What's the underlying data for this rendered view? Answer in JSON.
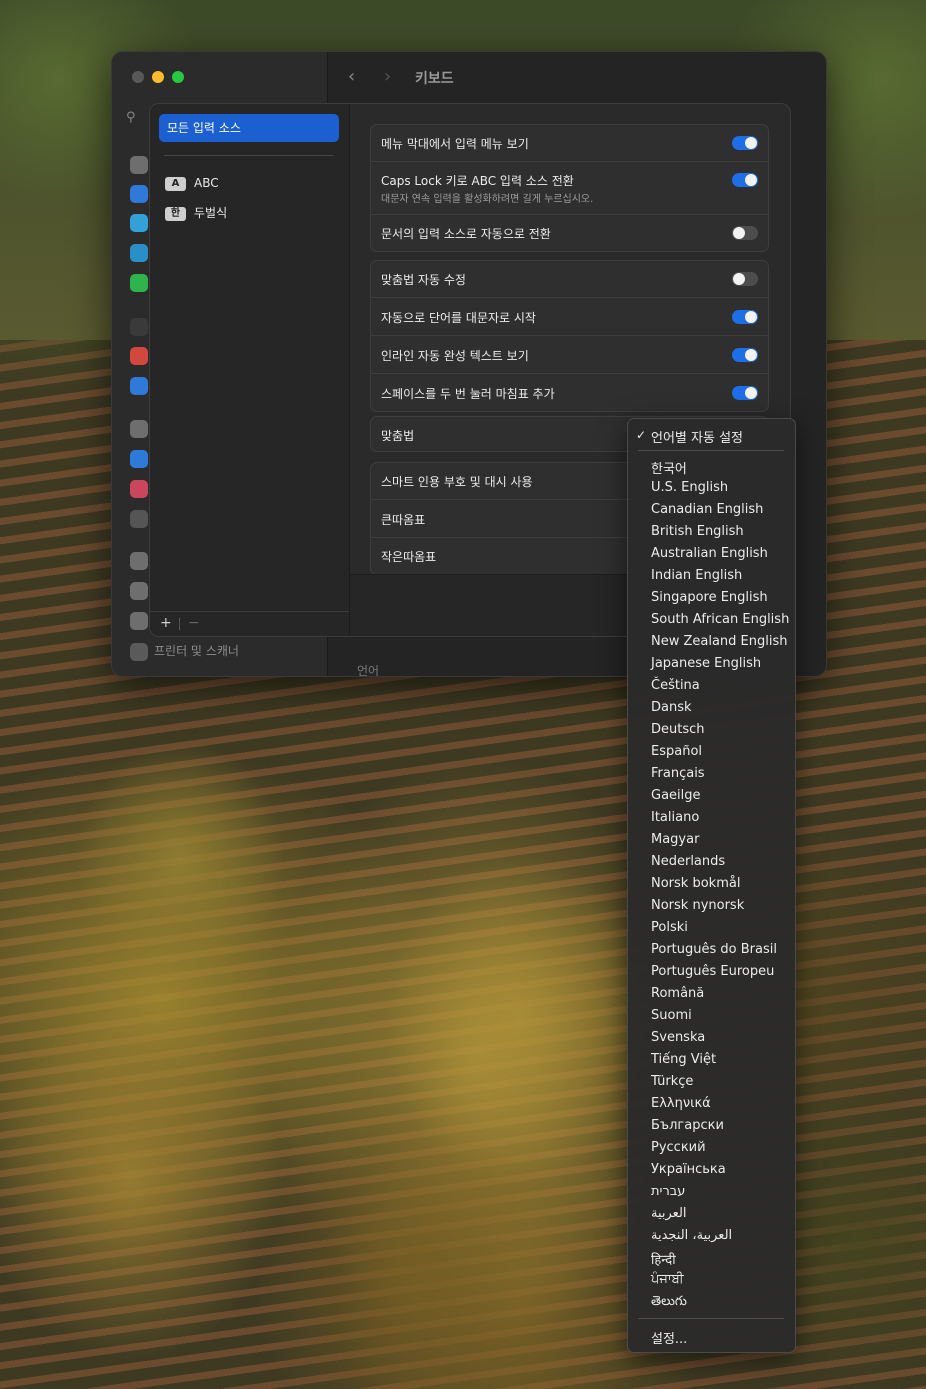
{
  "window": {
    "title": "키보드",
    "sidebar_footer": "프린터 및 스캐너",
    "background_label": "언어"
  },
  "sources": {
    "selected": "모든 입력 소스",
    "items": [
      {
        "badge": "A",
        "label": "ABC"
      },
      {
        "badge": "한",
        "label": "두벌식"
      }
    ],
    "add": "+",
    "remove": "−"
  },
  "settings": {
    "group1": [
      {
        "label": "메뉴 막대에서 입력 메뉴 보기",
        "on": true
      },
      {
        "label": "Caps Lock 키로 ABC 입력 소스 전환",
        "sub": "대문자 연속 입력을 활성화하려면 길게 누르십시오.",
        "on": true
      },
      {
        "label": "문서의 입력 소스로 자동으로 전환",
        "on": false
      }
    ],
    "group2": [
      {
        "label": "맞춤법 자동 수정",
        "on": false
      },
      {
        "label": "자동으로 단어를 대문자로 시작",
        "on": true
      },
      {
        "label": "인라인 자동 완성 텍스트 보기",
        "on": true
      },
      {
        "label": "스페이스를 두 번 눌러 마침표 추가",
        "on": true
      }
    ],
    "spelling_label": "맞춤법",
    "group4": [
      "스마트 인용 부호 및 대시 사용",
      "큰따옴표",
      "작은따옴표"
    ]
  },
  "spelling_menu": {
    "checked_item": "언어별 자동 설정",
    "languages": [
      "한국어",
      "U.S. English",
      "Canadian English",
      "British English",
      "Australian English",
      "Indian English",
      "Singapore English",
      "South African English",
      "New Zealand English",
      "Japanese English",
      "Čeština",
      "Dansk",
      "Deutsch",
      "Español",
      "Français",
      "Gaeilge",
      "Italiano",
      "Magyar",
      "Nederlands",
      "Norsk bokmål",
      "Norsk nynorsk",
      "Polski",
      "Português do Brasil",
      "Português Europeu",
      "Română",
      "Suomi",
      "Svenska",
      "Tiếng Việt",
      "Türkçe",
      "Ελληνικά",
      "Български",
      "Русский",
      "Українська",
      "עברית",
      "العربية",
      "العربية، النجدية",
      "हिन्दी",
      "ਪੰਜਾਬੀ",
      "తెలుగు"
    ],
    "settings_item": "설정..."
  },
  "colors": {
    "accent": "#1b5fd1",
    "toggle_on": "#1e6ee8"
  }
}
